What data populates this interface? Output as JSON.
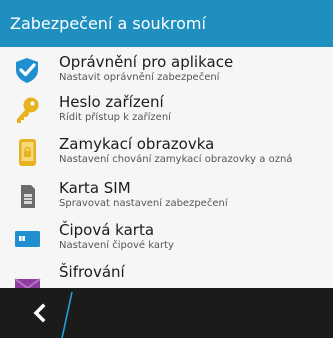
{
  "header": {
    "title": "Zabezpečení a soukromí"
  },
  "list": {
    "items": [
      {
        "title": "Oprávnění pro aplikace",
        "subtitle": "Nastavit oprávnění zabezpečení",
        "icon": "shield-check-icon"
      },
      {
        "title": "Heslo zařízení",
        "subtitle": "Řídit přístup k zařízení",
        "icon": "key-icon"
      },
      {
        "title": "Zamykací obrazovka",
        "subtitle": "Nastavení chování zamykací obrazovky a ozná",
        "icon": "lock-screen-icon"
      },
      {
        "title": "Karta SIM",
        "subtitle": "Spravovat nastavení zabezpečení",
        "icon": "sim-card-icon"
      },
      {
        "title": "Čipová karta",
        "subtitle": "Nastavení čipové karty",
        "icon": "smart-card-icon"
      },
      {
        "title": "Šifrování",
        "subtitle": "",
        "icon": "envelope-icon"
      }
    ]
  },
  "bottom_bar": {
    "back_icon": "chevron-left-icon"
  },
  "colors": {
    "header_bg": "#1f8fc0",
    "accent": "#1fa0d8",
    "bottom_bar_bg": "#1b1b1b"
  }
}
